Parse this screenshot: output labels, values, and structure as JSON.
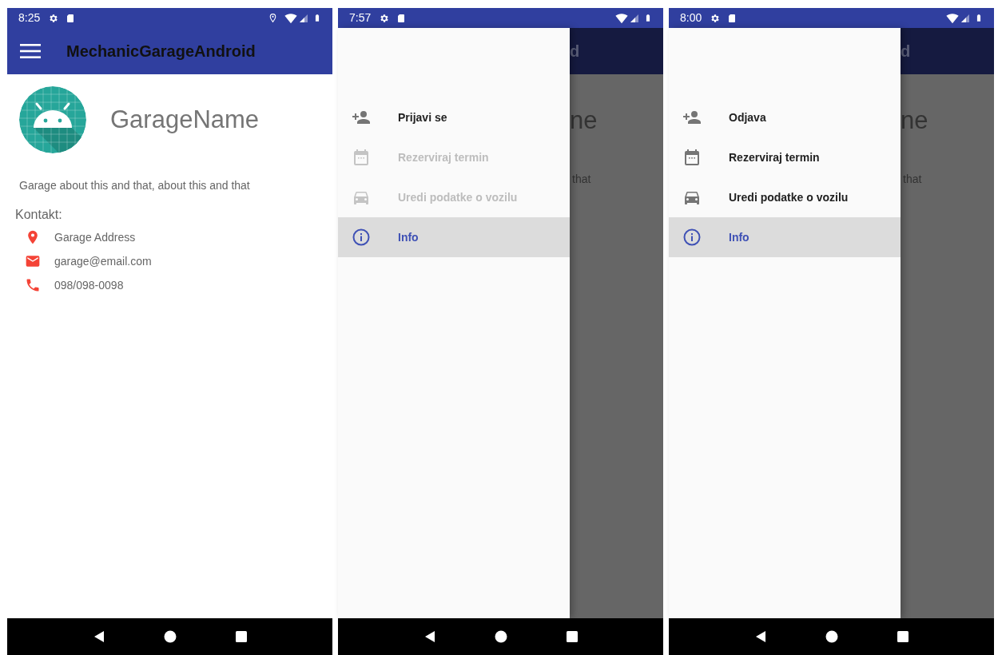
{
  "screens": [
    {
      "kind": "info",
      "status_bar": {
        "time": "8:25",
        "location": true
      },
      "app_bar": {
        "title": "MechanicGarageAndroid"
      },
      "garage": {
        "name": "GarageName",
        "description": "Garage about this and that, about this and that",
        "contact_heading": "Kontakt:",
        "contacts": [
          "Garage Address",
          "garage@email.com",
          "098/098-0098"
        ]
      }
    },
    {
      "kind": "drawer",
      "status_bar": {
        "time": "7:57",
        "location": false
      },
      "behind": {
        "title_end": "d",
        "name_end": "ne",
        "description_end": "that"
      },
      "drawer_items": [
        {
          "label": "Prijavi se",
          "disabled": false,
          "selected": false
        },
        {
          "label": "Rezerviraj termin",
          "disabled": true,
          "selected": false
        },
        {
          "label": "Uredi podatke o vozilu",
          "disabled": true,
          "selected": false
        },
        {
          "label": "Info",
          "disabled": false,
          "selected": true
        }
      ]
    },
    {
      "kind": "drawer",
      "status_bar": {
        "time": "8:00",
        "location": false
      },
      "behind": {
        "title_end": "d",
        "name_end": "ne",
        "description_end": "that"
      },
      "drawer_items": [
        {
          "label": "Odjava",
          "disabled": false,
          "selected": false
        },
        {
          "label": "Rezerviraj termin",
          "disabled": false,
          "selected": false
        },
        {
          "label": "Uredi podatke o vozilu",
          "disabled": false,
          "selected": false
        },
        {
          "label": "Info",
          "disabled": false,
          "selected": true
        }
      ]
    }
  ]
}
